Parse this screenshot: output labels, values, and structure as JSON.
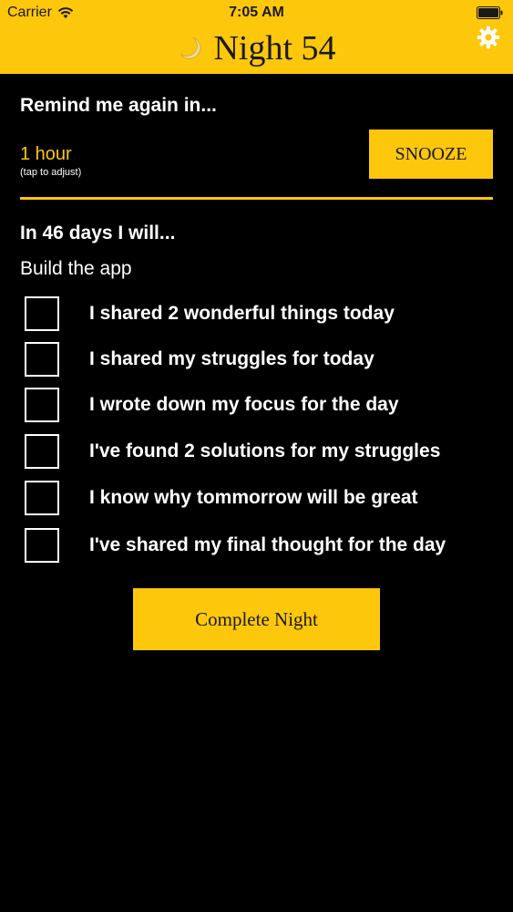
{
  "status_bar": {
    "carrier": "Carrier",
    "time": "7:05 AM"
  },
  "header": {
    "title": "Night 54",
    "moon_icon": "moon-icon",
    "settings_icon": "gear-icon"
  },
  "remind": {
    "heading": "Remind me again in...",
    "value": "1 hour",
    "hint": "(tap to adjust)",
    "snooze_label": "SNOOZE"
  },
  "goal": {
    "heading": "In 46 days I will...",
    "text": "Build the app"
  },
  "checklist": [
    {
      "label": "I shared 2 wonderful things today",
      "checked": false
    },
    {
      "label": "I shared my struggles for today",
      "checked": false
    },
    {
      "label": "I wrote down my focus for the day",
      "checked": false
    },
    {
      "label": "I've found 2 solutions for my struggles",
      "checked": false
    },
    {
      "label": "I know why tommorrow will be great",
      "checked": false
    },
    {
      "label": "I've shared my final thought for the day",
      "checked": false
    }
  ],
  "complete_label": "Complete Night",
  "colors": {
    "accent": "#fdc70c",
    "background": "#000000",
    "text": "#ffffff",
    "dark_text": "#1a1a1a"
  }
}
